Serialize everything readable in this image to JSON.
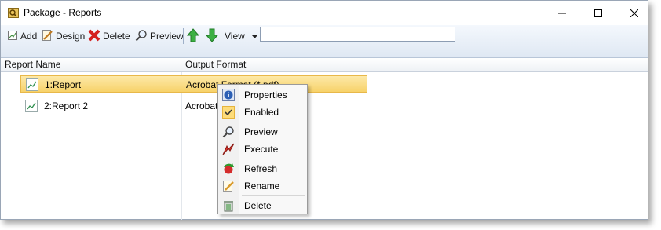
{
  "window": {
    "title": "Package - Reports"
  },
  "toolbar": {
    "add_label": "Add",
    "design_label": "Design",
    "delete_label": "Delete",
    "preview_label": "Preview",
    "view_label": "View",
    "search_value": ""
  },
  "grid": {
    "columns": [
      "Report Name",
      "Output Format"
    ],
    "rows": [
      {
        "name": "1:Report",
        "format": "Acrobat Format (*.pdf)",
        "selected": true
      },
      {
        "name": "2:Report 2",
        "format": "Acrobat Format (*.pdf)",
        "selected": false
      }
    ]
  },
  "context_menu": {
    "items": [
      {
        "label": "Properties",
        "icon": "info-icon"
      },
      {
        "label": "Enabled",
        "icon": "check-icon",
        "checked": true
      },
      {
        "label": "Preview",
        "icon": "magnifier-icon"
      },
      {
        "label": "Execute",
        "icon": "execute-arrow-icon"
      },
      {
        "label": "Refresh",
        "icon": "refresh-icon"
      },
      {
        "label": "Rename",
        "icon": "rename-pencil-icon"
      },
      {
        "label": "Delete",
        "icon": "trash-icon"
      }
    ]
  },
  "colors": {
    "selection": "#f7d26a",
    "toolbar_bg": "#dfe8f3",
    "delete_red": "#d42020",
    "arrow_green": "#2fa82f"
  }
}
